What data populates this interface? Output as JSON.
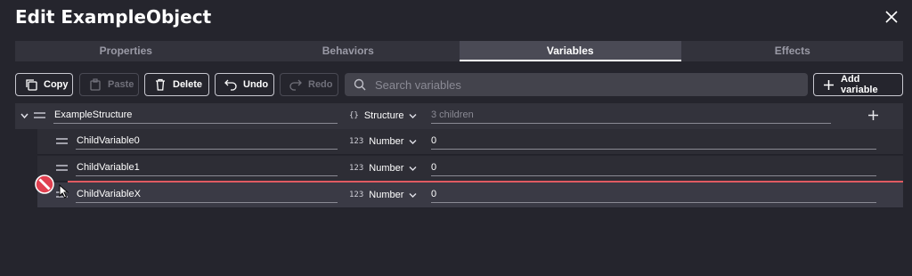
{
  "dialog": {
    "title": "Edit ExampleObject"
  },
  "tabs": [
    {
      "label": "Properties",
      "active": false
    },
    {
      "label": "Behaviors",
      "active": false
    },
    {
      "label": "Variables",
      "active": true
    },
    {
      "label": "Effects",
      "active": false
    }
  ],
  "toolbar": {
    "copy": "Copy",
    "paste": "Paste",
    "delete": "Delete",
    "undo": "Undo",
    "redo": "Redo",
    "search_placeholder": "Search variables",
    "add_variable": "Add variable"
  },
  "variables": {
    "parent": {
      "name": "ExampleStructure",
      "type": "Structure",
      "type_icon": "{}",
      "summary": "3 children"
    },
    "children": [
      {
        "name": "ChildVariable0",
        "type": "Number",
        "type_icon": "123",
        "value": "0"
      },
      {
        "name": "ChildVariable1",
        "type": "Number",
        "type_icon": "123",
        "value": "0"
      },
      {
        "name": "ChildVariableX",
        "type": "Number",
        "type_icon": "123",
        "value": "0"
      }
    ]
  },
  "colors": {
    "background": "#25252d",
    "drop_indicator": "#e05a62",
    "forbidden": "#e04050"
  }
}
